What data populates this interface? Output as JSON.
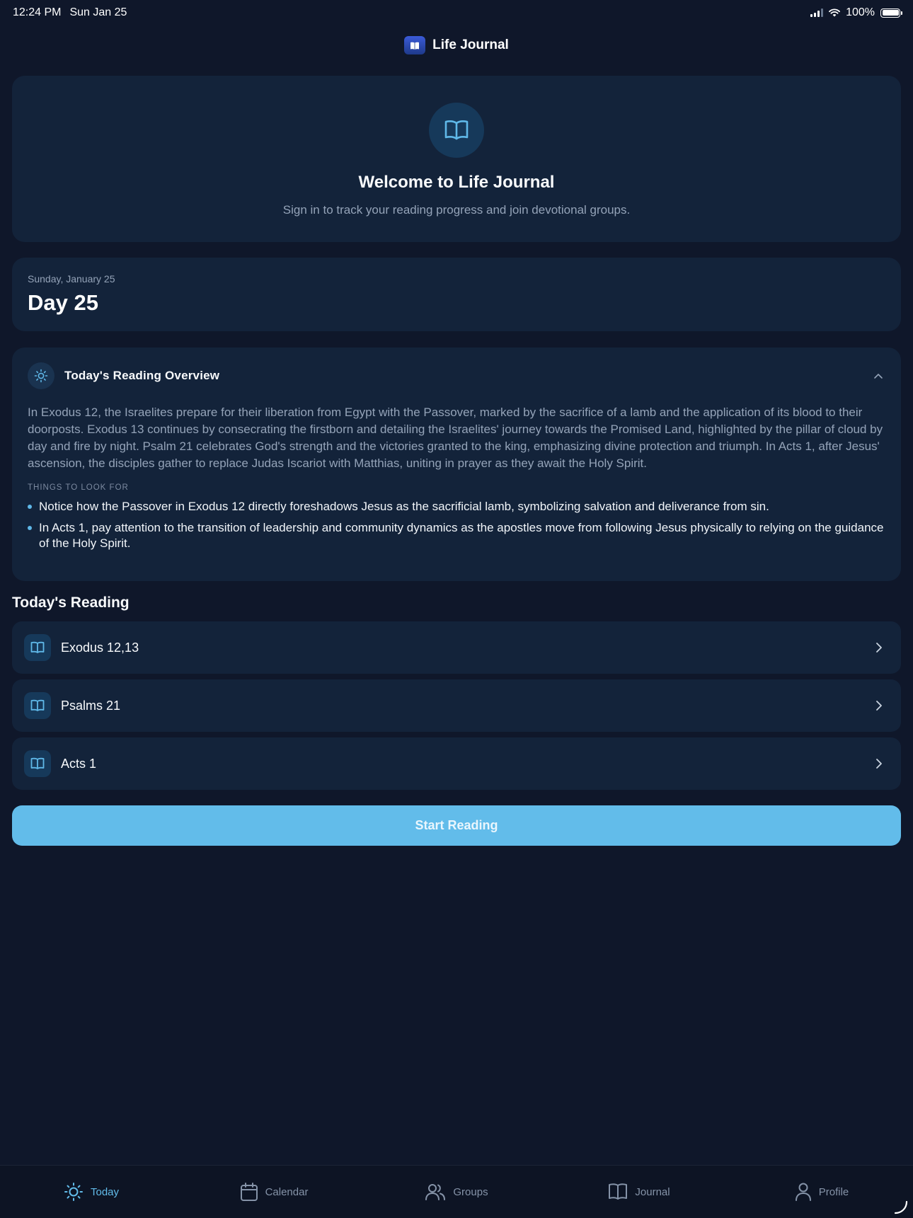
{
  "status_bar": {
    "time": "12:24 PM",
    "date": "Sun Jan 25",
    "battery": "100%"
  },
  "header": {
    "title": "Life Journal",
    "logo_icon": "book-icon"
  },
  "welcome": {
    "title": "Welcome to Life Journal",
    "subtitle": "Sign in to track your reading progress and join devotional groups."
  },
  "day": {
    "date": "Sunday, January 25",
    "title": "Day 25"
  },
  "overview": {
    "title": "Today's Reading Overview",
    "text": "In Exodus 12, the Israelites prepare for their liberation from Egypt with the Passover, marked by the sacrifice of a lamb and the application of its blood to their doorposts. Exodus 13 continues by consecrating the firstborn and detailing the Israelites' journey towards the Promised Land, highlighted by the pillar of cloud by day and fire by night. Psalm 21 celebrates God's strength and the victories granted to the king, emphasizing divine protection and triumph. In Acts 1, after Jesus' ascension, the disciples gather to replace Judas Iscariot with Matthias, uniting in prayer as they await the Holy Spirit.",
    "things_label": "THINGS TO LOOK FOR",
    "things": [
      "Notice how the Passover in Exodus 12 directly foreshadows Jesus as the sacrificial lamb, symbolizing salvation and deliverance from sin.",
      "In Acts 1, pay attention to the transition of leadership and community dynamics as the apostles move from following Jesus physically to relying on the guidance of the Holy Spirit."
    ]
  },
  "reading": {
    "title": "Today's Reading",
    "items": [
      {
        "label": "Exodus 12,13"
      },
      {
        "label": "Psalms 21"
      },
      {
        "label": "Acts 1"
      }
    ],
    "start_label": "Start Reading"
  },
  "tabs": [
    {
      "label": "Today",
      "icon": "sun-icon",
      "active": true
    },
    {
      "label": "Calendar",
      "icon": "calendar-icon",
      "active": false
    },
    {
      "label": "Groups",
      "icon": "users-icon",
      "active": false
    },
    {
      "label": "Journal",
      "icon": "book-open-icon",
      "active": false
    },
    {
      "label": "Profile",
      "icon": "person-icon",
      "active": false
    }
  ],
  "colors": {
    "background": "#0f172a",
    "card": "#13233a",
    "accent": "#62bcea"
  }
}
